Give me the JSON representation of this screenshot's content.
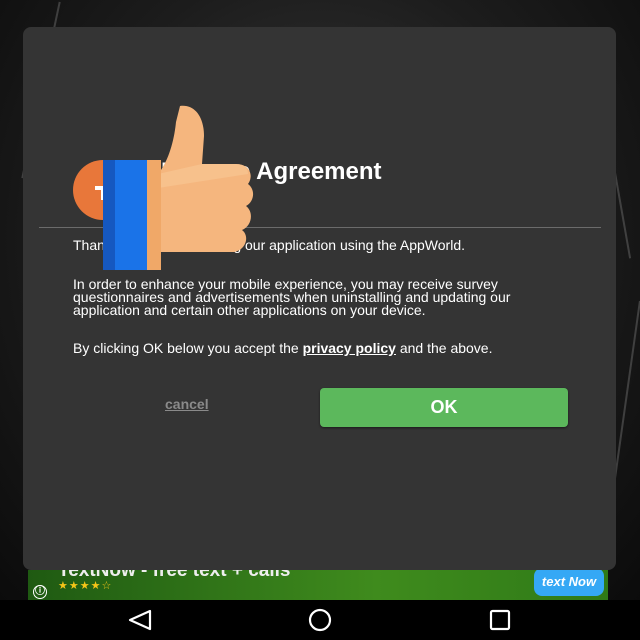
{
  "dialog": {
    "title": "License Agreement",
    "paragraph1": "Thank you for downloading our application using the AppWorld.",
    "paragraph2": "In order to enhance your mobile experience, you may receive survey questionnaires and advertisements when uninstalling and updating our application and certain other applications on your device.",
    "paragraph3_prefix": "By clicking OK below you accept the ",
    "privacy_link": "privacy policy",
    "paragraph3_suffix": " and the above.",
    "cancel_label": "cancel",
    "ok_label": "OK",
    "ok_color": "#5cb85c"
  },
  "ad": {
    "title": "TextNow - free text + calls",
    "stars": "★★★★☆",
    "info_icon": "ⓘ",
    "logo_text": "text Now"
  },
  "navbar": {
    "back_icon": "back-triangle-icon",
    "home_icon": "home-circle-icon",
    "recent_icon": "recent-square-icon"
  },
  "overlay": {
    "icon": "thumbs-up-icon"
  }
}
